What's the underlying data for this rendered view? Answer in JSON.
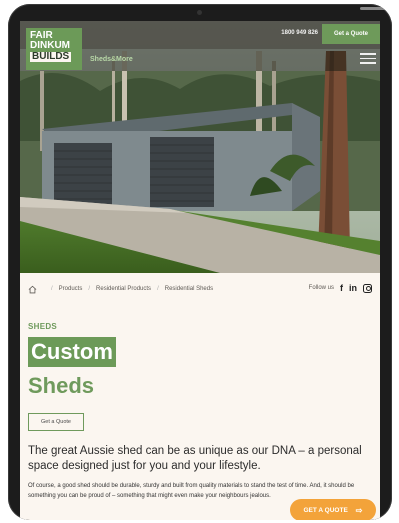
{
  "top_bar": {
    "phone": "1800 949 826",
    "quote_label": "Get a Quote"
  },
  "logo": {
    "line1": "FAIR",
    "line2": "DINKUM",
    "line3": "BUILDS"
  },
  "tagline": "Sheds&More",
  "breadcrumb": {
    "items": [
      "Products",
      "Residential Products",
      "Residential Sheds"
    ],
    "separator": "/"
  },
  "social": {
    "follow_label": "Follow us",
    "facebook": "f",
    "linkedin": "in"
  },
  "content": {
    "eyebrow": "SHEDS",
    "heading_line1": "Custom",
    "heading_line2": "Sheds",
    "cta_label": "Get a Quote",
    "lead": "The great Aussie shed can be as unique as our DNA – a personal space designed just for you and your lifestyle.",
    "body": "Of course, a good shed should be durable, sturdy and built from quality materials to stand the test of time. And, it should be something you can be proud of – something that might even make your neighbours jealous."
  },
  "floating_cta": {
    "label": "GET A QUOTE",
    "arrow": "⇨"
  },
  "colors": {
    "brand_green": "#6c9a58",
    "accent_orange": "#f3a33a",
    "page_bg": "#fbf6f0"
  }
}
